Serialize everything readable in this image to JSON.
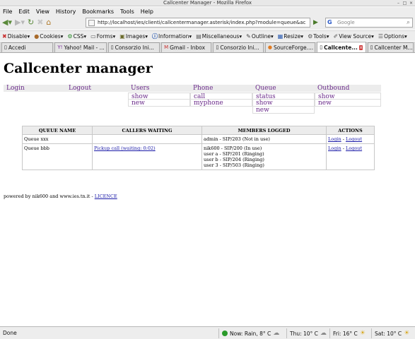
{
  "window": {
    "title": "Callcenter Manager - Mozilla Firefox"
  },
  "menubar": [
    "File",
    "Edit",
    "View",
    "History",
    "Bookmarks",
    "Tools",
    "Help"
  ],
  "nav": {
    "url": "http://localhost/ies/clienti/callcentermanager.asterisk/index.php?module=queue&ac",
    "search_placeholder": "Google"
  },
  "devbar": [
    "Disable▾",
    "Cookies▾",
    "CSS▾",
    "Forms▾",
    "Images▾",
    "Information▾",
    "Miscellaneous▾",
    "Outline▾",
    "Resize▾",
    "Tools▾",
    "View Source▾",
    "Options▾"
  ],
  "tabs": [
    {
      "label": "Accedi",
      "active": false
    },
    {
      "label": "Yahoo! Mail - ...",
      "active": false
    },
    {
      "label": "Consorzio Ini...",
      "active": false
    },
    {
      "label": "Gmail - Inbox",
      "active": false
    },
    {
      "label": "Consorzio Ini...",
      "active": false
    },
    {
      "label": "SourceForge....",
      "active": false
    },
    {
      "label": "Callcente...",
      "active": true
    },
    {
      "label": "Callcenter M...",
      "active": false
    }
  ],
  "page": {
    "title": "Callcenter manager",
    "menu": {
      "login": "Login",
      "logout": "Logout",
      "users": {
        "label": "Users",
        "items": [
          "show",
          "new"
        ]
      },
      "phone": {
        "label": "Phone",
        "items": [
          "call",
          "myphone"
        ]
      },
      "queue": {
        "label": "Queue",
        "items": [
          "status",
          "show",
          "new"
        ]
      },
      "outbound": {
        "label": "Outbound",
        "items": [
          "show",
          "new"
        ]
      }
    },
    "table": {
      "headers": [
        "QUEUE NAME",
        "CALLERS WAITING",
        "MEMBERS LOGGED",
        "ACTIONS"
      ],
      "rows": [
        {
          "name": "Queue xxx",
          "callers": "",
          "members": [
            "admin - SIP/203 (Not in use)"
          ],
          "login": "Login",
          "sep": " - ",
          "logout": "Logout"
        },
        {
          "name": "Queue bbb",
          "callers": "Pickup call (waiting: 0:02)",
          "members": [
            "nik600 - SIP/200 (In use)",
            "user a - SIP/201 (Ringing)",
            "user b - SIP/204 (Ringing)",
            "user 3 - SIP/503 (Ringing)"
          ],
          "login": "Login",
          "sep": " - ",
          "logout": "Logout"
        }
      ]
    },
    "footer": {
      "text": "powered by nik600 and www.ies.tn.it - ",
      "link": "LICENCE"
    }
  },
  "status": {
    "text": "Done",
    "weather": [
      {
        "label": "Now: Rain, 8° C",
        "icon": "rain-cloud-icon"
      },
      {
        "label": "Thu: 10° C",
        "icon": "cloud-icon"
      },
      {
        "label": "Fri: 16° C",
        "icon": "sun-cloud-icon"
      },
      {
        "label": "Sat: 10° C",
        "icon": "sun-cloud-icon"
      }
    ]
  }
}
